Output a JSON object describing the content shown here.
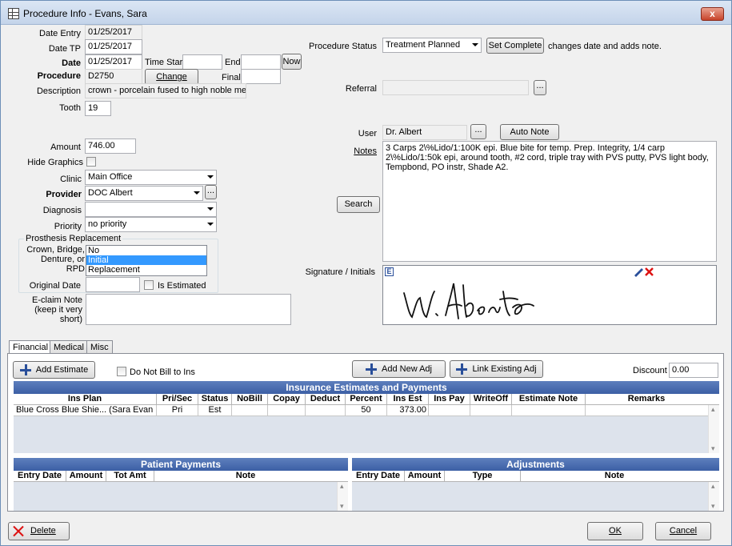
{
  "window": {
    "title": "Procedure Info - Evans, Sara",
    "close": "x"
  },
  "left": {
    "date_entry_label": "Date Entry",
    "date_entry": "01/25/2017",
    "date_tp_label": "Date TP",
    "date_tp": "01/25/2017",
    "date_label": "Date",
    "date": "01/25/2017",
    "time_start_label": "Time Start",
    "end_label": "End",
    "now_button": "Now",
    "procedure_label": "Procedure",
    "procedure_code": "D2750",
    "change_button": "Change",
    "final_label": "Final",
    "description_label": "Description",
    "description": "crown - porcelain fused to high noble metal",
    "tooth_label": "Tooth",
    "tooth": "19",
    "amount_label": "Amount",
    "amount": "746.00",
    "hide_graphics_label": "Hide Graphics",
    "clinic_label": "Clinic",
    "clinic": "Main Office",
    "provider_label": "Provider",
    "provider": "DOC Albert",
    "provider_pick": "...",
    "diagnosis_label": "Diagnosis",
    "diagnosis": "",
    "priority_label": "Priority",
    "priority": "no priority",
    "prosthesis_group": "Prosthesis Replacement",
    "crown_label": "Crown, Bridge, Denture, or RPD",
    "prosthesis_options": [
      "No",
      "Initial",
      "Replacement"
    ],
    "original_date_label": "Original Date",
    "is_estimated_label": "Is Estimated",
    "eclaim_label": "E-claim Note (keep it very short)"
  },
  "right": {
    "status_label": "Procedure Status",
    "status": "Treatment Planned",
    "set_complete": "Set Complete",
    "set_complete_note": "changes date and adds note.",
    "referral_label": "Referral",
    "referral_pick": "...",
    "user_label": "User",
    "user": "Dr. Albert",
    "user_pick": "...",
    "auto_note": "Auto Note",
    "notes_label": "Notes",
    "notes": "3 Carps 2\\%Lido/1:100K epi. Blue bite for temp. Prep. Integrity, 1/4 carp 2\\%Lido/1:50k epi, around tooth, #2 cord, triple tray with PVS putty, PVS light body, Tempbond, PO instr, Shade A2.",
    "search": "Search",
    "signature_label": "Signature / Initials",
    "sig_badge": "E"
  },
  "tabs": [
    "Financial",
    "Medical",
    "Misc"
  ],
  "financial": {
    "add_estimate": "Add Estimate",
    "do_not_bill": "Do Not Bill to Ins",
    "add_new_adj": "Add New Adj",
    "link_existing_adj": "Link Existing Adj",
    "discount_label": "Discount",
    "discount": "0.00",
    "ins_title": "Insurance Estimates and Payments",
    "ins_columns": [
      "Ins Plan",
      "Pri/Sec",
      "Status",
      "NoBill",
      "Copay",
      "Deduct",
      "Percent",
      "Ins Est",
      "Ins Pay",
      "WriteOff",
      "Estimate Note",
      "Remarks"
    ],
    "ins_rows": [
      [
        "Blue Cross Blue Shie... (Sara Evan",
        "Pri",
        "Est",
        "",
        "",
        "",
        "50",
        "373.00",
        "",
        "",
        "",
        ""
      ]
    ],
    "patient_title": "Patient Payments",
    "patient_columns": [
      "Entry Date",
      "Amount",
      "Tot Amt",
      "Note"
    ],
    "adj_title": "Adjustments",
    "adj_columns": [
      "Entry Date",
      "Amount",
      "Type",
      "Note"
    ]
  },
  "footer": {
    "delete": "Delete",
    "ok": "OK",
    "cancel": "Cancel"
  }
}
